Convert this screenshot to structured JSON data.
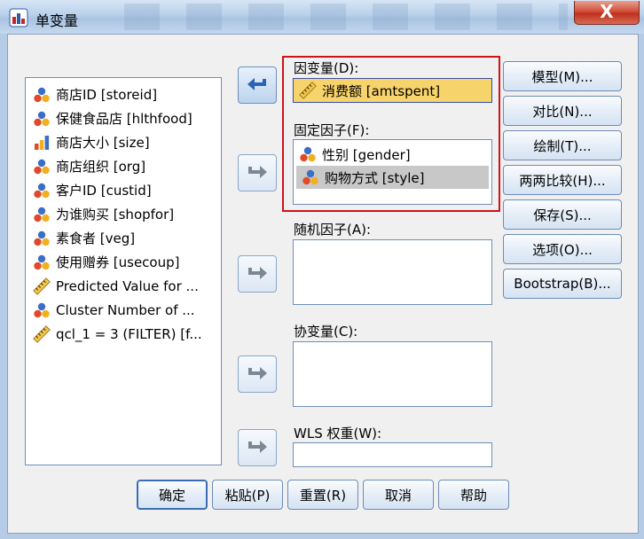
{
  "window": {
    "title": "单变量",
    "close_label": "X"
  },
  "variables": [
    {
      "label": "商店ID [storeid]",
      "icon": "nominal-icon"
    },
    {
      "label": "保健食品店 [hlthfood]",
      "icon": "nominal-icon"
    },
    {
      "label": "商店大小 [size]",
      "icon": "ordinal-icon"
    },
    {
      "label": "商店组织 [org]",
      "icon": "nominal-icon"
    },
    {
      "label": "客户ID [custid]",
      "icon": "nominal-icon"
    },
    {
      "label": "为谁购买 [shopfor]",
      "icon": "nominal-icon"
    },
    {
      "label": "素食者 [veg]",
      "icon": "nominal-icon"
    },
    {
      "label": "使用赠券 [usecoup]",
      "icon": "nominal-icon"
    },
    {
      "label": "Predicted Value for ...",
      "icon": "scale-icon"
    },
    {
      "label": "Cluster Number of ...",
      "icon": "nominal-icon"
    },
    {
      "label": "qcl_1 = 3 (FILTER) [f...",
      "icon": "scale-icon"
    }
  ],
  "dependent": {
    "label": "因变量(D):",
    "value": "消费额 [amtspent]"
  },
  "fixed_factors": {
    "label": "固定因子(F):",
    "items": [
      "性别 [gender]",
      "购物方式 [style]"
    ]
  },
  "random_factors": {
    "label": "随机因子(A):"
  },
  "covariates": {
    "label": "协变量(C):"
  },
  "wls": {
    "label": "WLS 权重(W):"
  },
  "side_buttons": [
    "模型(M)...",
    "对比(N)...",
    "绘制(T)...",
    "两两比较(H)...",
    "保存(S)...",
    "选项(O)...",
    "Bootstrap(B)..."
  ],
  "bottom_buttons": [
    "确定",
    "粘贴(P)",
    "重置(R)",
    "取消",
    "帮助"
  ],
  "colors": {
    "highlight_frame": "#d0121b",
    "selected_dependent_bg": "#f7d36b"
  }
}
